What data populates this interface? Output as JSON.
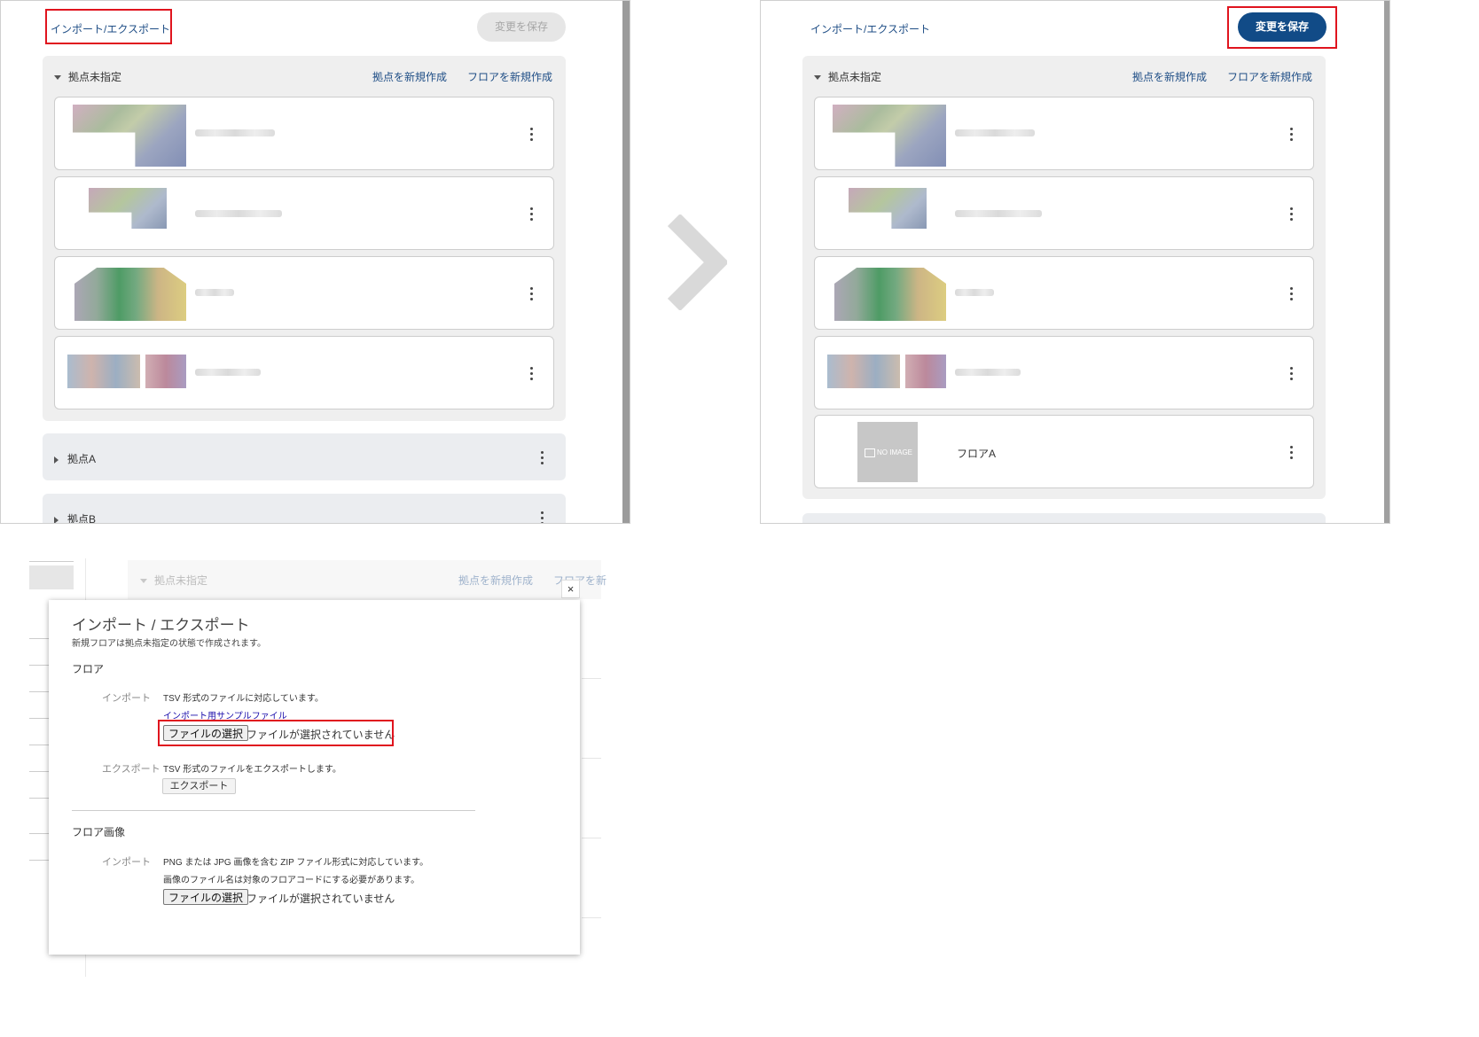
{
  "left_panel": {
    "import_export_link": "インポート/エクスポート",
    "save_button": "変更を保存",
    "group_unassigned": {
      "title": "拠点未指定",
      "new_site_link": "拠点を新規作成",
      "new_floor_link": "フロアを新規作成"
    },
    "site_a": "拠点A",
    "site_b": "拠点B"
  },
  "right_panel": {
    "import_export_link": "インポート/エクスポート",
    "save_button": "変更を保存",
    "group_unassigned": {
      "title": "拠点未指定",
      "new_site_link": "拠点を新規作成",
      "new_floor_link": "フロアを新規作成"
    },
    "new_floor": {
      "no_image_text": "NO IMAGE",
      "name": "フロアA"
    }
  },
  "background_page": {
    "group_title": "拠点未指定",
    "new_site_link": "拠点を新規作成",
    "new_floor_link_partial": "フロアを新"
  },
  "modal": {
    "close": "×",
    "title": "インポート / エクスポート",
    "subtitle": "新規フロアは拠点未指定の状態で作成されます。",
    "floor_section": {
      "title": "フロア",
      "import_label": "インポート",
      "import_desc": "TSV 形式のファイルに対応しています。",
      "sample_link": "インポート用サンプルファイル",
      "file_button": "ファイルの選択",
      "file_status": "ファイルが選択されていません",
      "export_label": "エクスポート",
      "export_desc": "TSV 形式のファイルをエクスポートします。",
      "export_button": "エクスポート"
    },
    "image_section": {
      "title": "フロア画像",
      "import_label": "インポート",
      "desc_line1": "PNG または JPG 画像を含む ZIP ファイル形式に対応しています。",
      "desc_line2": "画像のファイル名は対象のフロアコードにする必要があります。",
      "file_button": "ファイルの選択",
      "file_status": "ファイルが選択されていません"
    }
  },
  "colors": {
    "link": "#1f4e86",
    "save_active": "#114b87",
    "highlight": "#e0141e"
  },
  "icons": {
    "arrow": "chevron-right-icon",
    "kebab": "kebab-menu-icon",
    "close": "close-icon",
    "expand": "triangle-down-icon",
    "collapse": "triangle-right-icon",
    "no_image": "image-placeholder-icon"
  }
}
